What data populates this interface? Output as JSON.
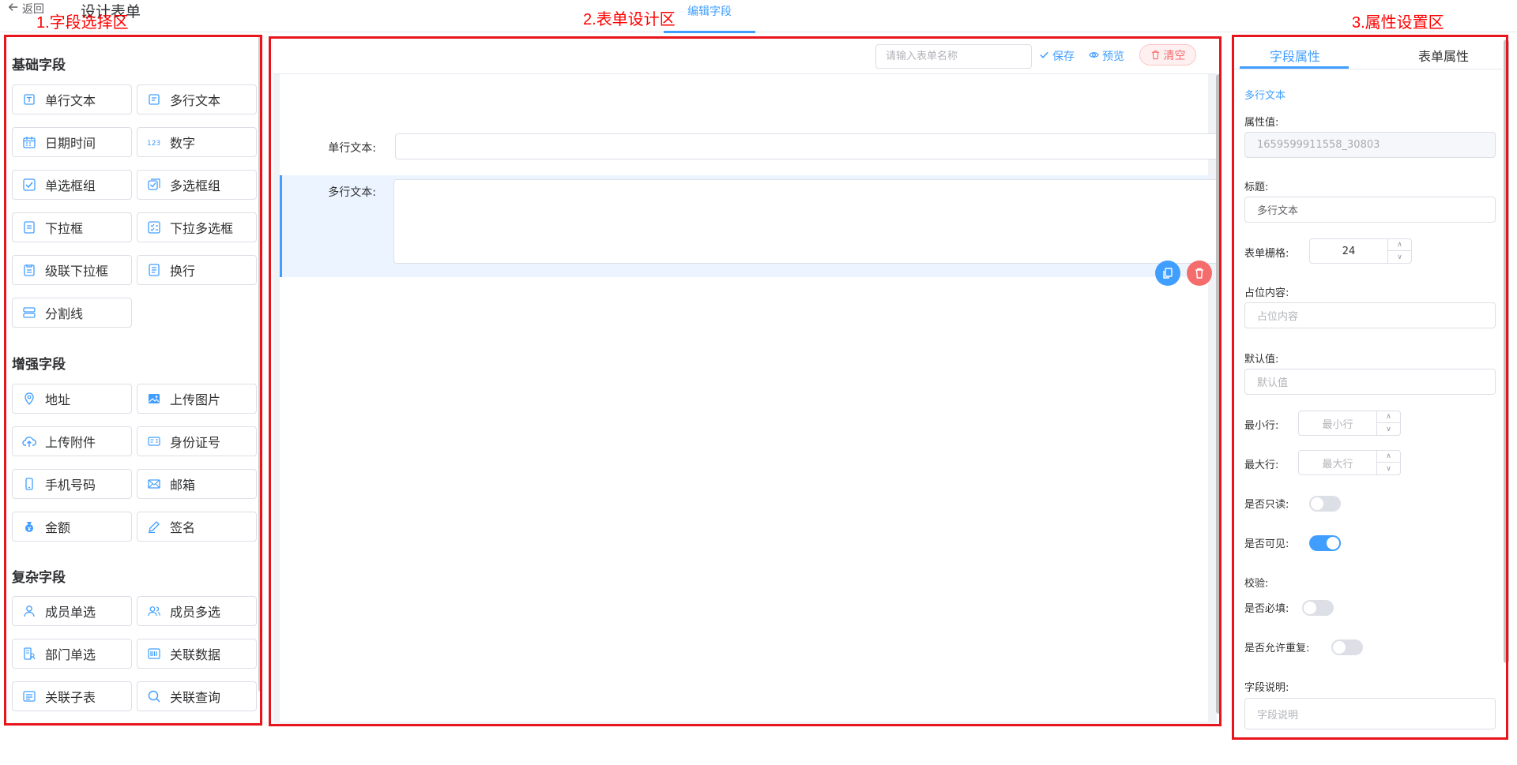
{
  "header": {
    "back_label": "返回",
    "title": "设计表单",
    "active_tab": "编辑字段"
  },
  "annotations": {
    "field_area": "1.字段选择区",
    "design_area": "2.表单设计区",
    "property_area": "3.属性设置区"
  },
  "colors": {
    "accent": "#409eff",
    "danger": "#f56c6c",
    "annotation": "#ff0000"
  },
  "left": {
    "groups": [
      {
        "title": "基础字段"
      },
      {
        "title": "增强字段"
      },
      {
        "title": "复杂字段"
      }
    ],
    "fields": [
      {
        "label": "单行文本",
        "icon": "single-line-text-icon"
      },
      {
        "label": "多行文本",
        "icon": "multi-line-text-icon"
      },
      {
        "label": "日期时间",
        "icon": "calendar-icon"
      },
      {
        "label": "数字",
        "icon": "number-123-icon"
      },
      {
        "label": "单选框组",
        "icon": "checkbox-icon"
      },
      {
        "label": "多选框组",
        "icon": "multi-checkbox-icon"
      },
      {
        "label": "下拉框",
        "icon": "dropdown-icon"
      },
      {
        "label": "下拉多选框",
        "icon": "dropdown-multi-icon"
      },
      {
        "label": "级联下拉框",
        "icon": "cascade-icon"
      },
      {
        "label": "换行",
        "icon": "line-break-icon"
      },
      {
        "label": "分割线",
        "icon": "divider-icon"
      },
      {
        "label": "地址",
        "icon": "location-pin-icon"
      },
      {
        "label": "上传图片",
        "icon": "image-upload-icon"
      },
      {
        "label": "上传附件",
        "icon": "cloud-upload-icon"
      },
      {
        "label": "身份证号",
        "icon": "id-card-icon"
      },
      {
        "label": "手机号码",
        "icon": "mobile-phone-icon"
      },
      {
        "label": "邮箱",
        "icon": "mail-icon"
      },
      {
        "label": "金额",
        "icon": "money-bag-icon"
      },
      {
        "label": "签名",
        "icon": "pen-icon"
      },
      {
        "label": "成员单选",
        "icon": "user-icon"
      },
      {
        "label": "成员多选",
        "icon": "users-icon"
      },
      {
        "label": "部门单选",
        "icon": "department-icon"
      },
      {
        "label": "关联数据",
        "icon": "barcode-icon"
      },
      {
        "label": "关联子表",
        "icon": "subtable-icon"
      },
      {
        "label": "关联查询",
        "icon": "search-icon"
      }
    ]
  },
  "center": {
    "form_name_placeholder": "请输入表单名称",
    "save_label": "保存",
    "preview_label": "预览",
    "clear_label": "清空",
    "rows": [
      {
        "label": "单行文本:"
      },
      {
        "label": "多行文本:"
      }
    ]
  },
  "right": {
    "tab_field": "字段属性",
    "tab_form": "表单属性",
    "field_type": "多行文本",
    "prop_value_label": "属性值:",
    "prop_value": "1659599911558_30803",
    "title_label": "标题:",
    "title_value": "多行文本",
    "grid_label": "表单栅格:",
    "grid_value": "24",
    "placeholder_label": "占位内容:",
    "placeholder_ph": "占位内容",
    "default_label": "默认值:",
    "default_ph": "默认值",
    "min_rows_label": "最小行:",
    "min_rows_ph": "最小行",
    "max_rows_label": "最大行:",
    "max_rows_ph": "最大行",
    "readonly_label": "是否只读:",
    "readonly": false,
    "visible_label": "是否可见:",
    "visible": true,
    "validate_label": "校验:",
    "required_label": "是否必填:",
    "required": false,
    "repeat_label": "是否允许重复:",
    "repeat": false,
    "desc_label": "字段说明:",
    "desc_ph": "字段说明"
  }
}
